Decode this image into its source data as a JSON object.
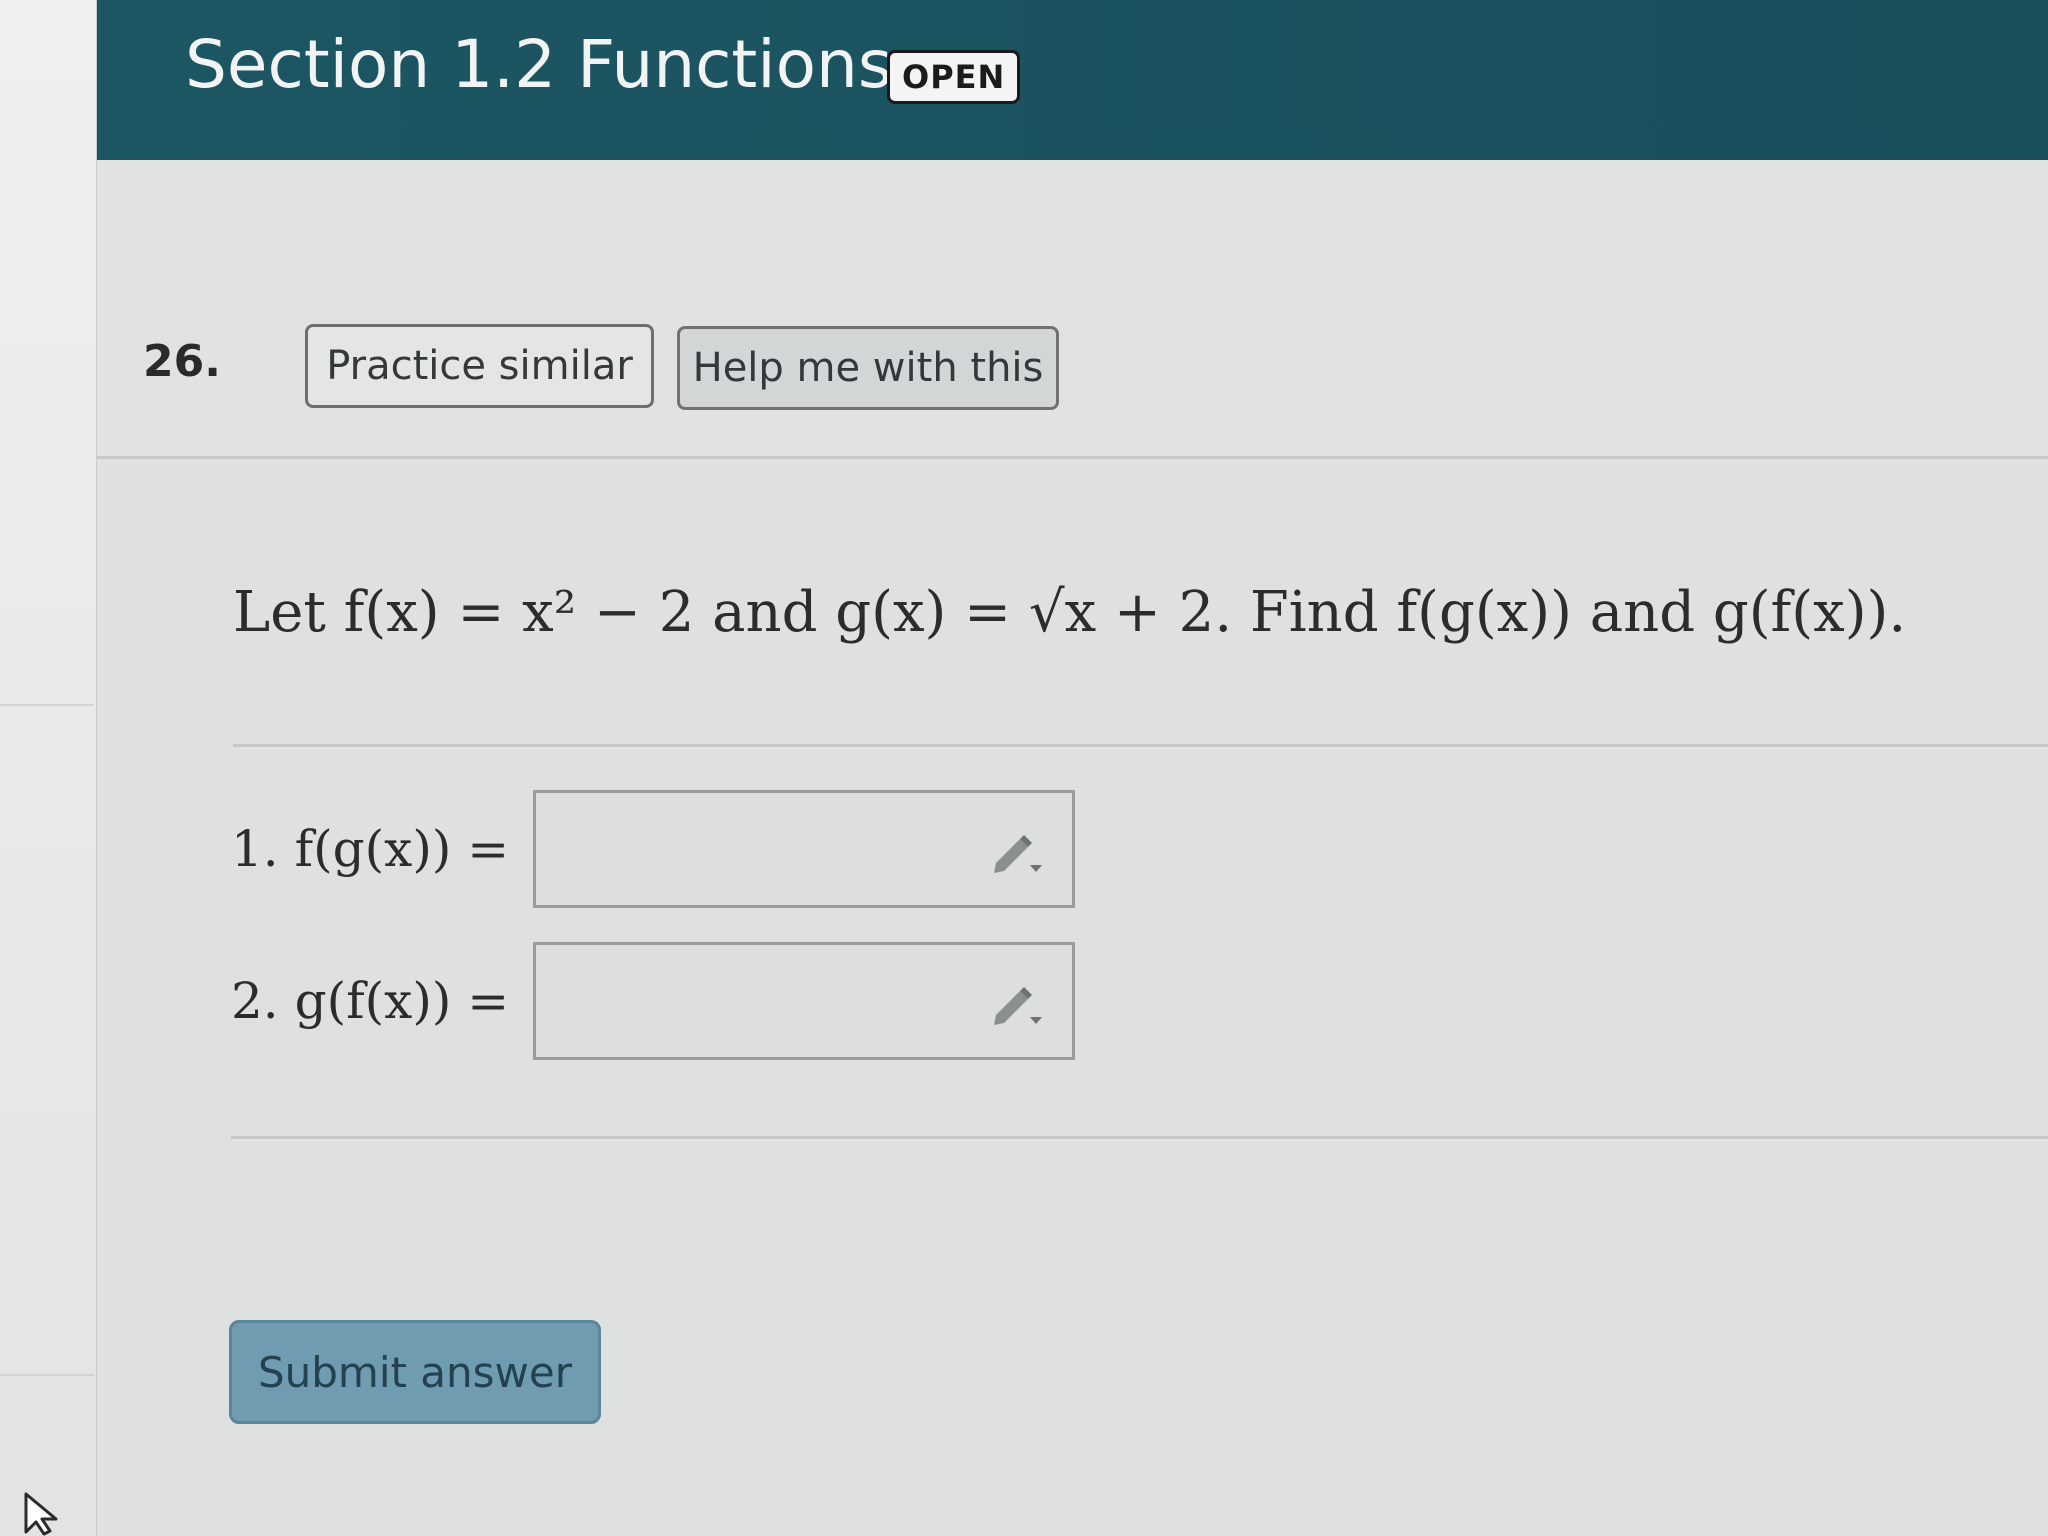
{
  "header": {
    "title": "Section 1.2 Functions",
    "status_badge": "OPEN"
  },
  "question": {
    "number": "26.",
    "practice_button": "Practice similar",
    "help_button": "Help me with this",
    "prompt": "Let f(x) = x² − 2 and g(x) = √x + 2. Find f(g(x)) and g(f(x)).",
    "answers": [
      {
        "label": "1. f(g(x)) =",
        "value": ""
      },
      {
        "label": "2. g(f(x)) =",
        "value": ""
      }
    ],
    "submit_button": "Submit answer"
  },
  "icons": {
    "answer_tool": "pencil-dropdown-icon",
    "cursor": "mouse-pointer-icon"
  },
  "colors": {
    "header_bg": "#1d5663",
    "submit_bg": "#6f9cb1",
    "page_bg": "#dfe1e0"
  }
}
